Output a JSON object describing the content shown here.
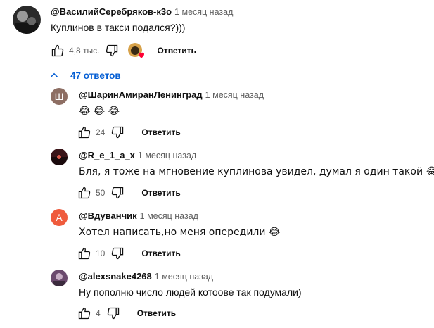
{
  "top": {
    "author": "@ВасилийСеребряков-к3о",
    "time": "1 месяц назад",
    "text": "Куплинов в такси подался?)))",
    "likes": "4,8 тыс.",
    "reply": "Ответить"
  },
  "replies_toggle": {
    "label": "47 ответов"
  },
  "replies": [
    {
      "author": "@ШаринАмиранЛенинград",
      "time": "1 месяц назад",
      "text": "😂 😂 😂",
      "likes": "24",
      "reply": "Ответить",
      "avatar_letter": "Ш",
      "avatar_color": "#8d6e63"
    },
    {
      "author": "@R_e_1_a_x",
      "time": "1 месяц назад",
      "text": "Бля, я тоже на мгновение куплинова увидел, думал я один такой 😂",
      "likes": "50",
      "reply": "Ответить"
    },
    {
      "author": "@Вдуванчик",
      "time": "1 месяц назад",
      "text": "Хотел написать,но меня опередили 😂",
      "likes": "10",
      "reply": "Ответить",
      "avatar_letter": "А",
      "avatar_color": "#ef5b3d"
    },
    {
      "author": "@alexsnake4268",
      "time": "1 месяц назад",
      "text": "Ну пополню число людей котоове так подумали)",
      "likes": "4",
      "reply": "Ответить"
    }
  ]
}
